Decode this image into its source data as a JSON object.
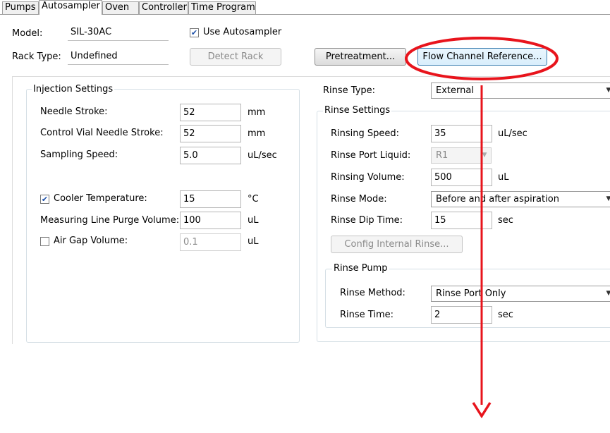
{
  "tabs": [
    {
      "label": "Pumps"
    },
    {
      "label": "Autosampler",
      "active": true
    },
    {
      "label": "Oven"
    },
    {
      "label": "Controller"
    },
    {
      "label": "Time Program"
    }
  ],
  "header": {
    "model_label": "Model:",
    "model_value": "SIL-30AC",
    "use_autosampler_label": "Use Autosampler",
    "use_autosampler_checked": true,
    "rack_type_label": "Rack Type:",
    "rack_type_value": "Undefined",
    "detect_rack_label": "Detect Rack",
    "pretreatment_label": "Pretreatment...",
    "flow_channel_reference_label": "Flow Channel Reference..."
  },
  "injection": {
    "title": "Injection Settings",
    "needle_stroke": {
      "label": "Needle Stroke:",
      "value": "52",
      "unit": "mm"
    },
    "control_vial_needle_stroke": {
      "label": "Control Vial Needle Stroke:",
      "value": "52",
      "unit": "mm"
    },
    "sampling_speed": {
      "label": "Sampling Speed:",
      "value": "5.0",
      "unit": "uL/sec"
    },
    "cooler_temperature": {
      "label": "Cooler Temperature:",
      "value": "15",
      "unit": "°C",
      "checked": true
    },
    "measuring_line_purge_volume": {
      "label": "Measuring Line Purge Volume:",
      "value": "100",
      "unit": "uL"
    },
    "air_gap_volume": {
      "label": "Air Gap Volume:",
      "value": "0.1",
      "unit": "uL",
      "checked": false
    }
  },
  "rinse": {
    "rinse_type_label": "Rinse Type:",
    "rinse_type_value": "External",
    "settings_title": "Rinse Settings",
    "rinsing_speed": {
      "label": "Rinsing Speed:",
      "value": "35",
      "unit": "uL/sec"
    },
    "rinse_port_liquid": {
      "label": "Rinse Port Liquid:",
      "value": "R1"
    },
    "rinsing_volume": {
      "label": "Rinsing Volume:",
      "value": "500",
      "unit": "uL"
    },
    "rinse_mode": {
      "label": "Rinse Mode:",
      "value": "Before and after aspiration"
    },
    "rinse_dip_time": {
      "label": "Rinse Dip Time:",
      "value": "15",
      "unit": "sec"
    },
    "config_internal_rinse_label": "Config Internal Rinse...",
    "pump_title": "Rinse Pump",
    "rinse_method": {
      "label": "Rinse Method:",
      "value": "Rinse Port Only"
    },
    "rinse_time": {
      "label": "Rinse Time:",
      "value": "2",
      "unit": "sec"
    }
  },
  "annotation": {
    "color": "#e8141c"
  }
}
